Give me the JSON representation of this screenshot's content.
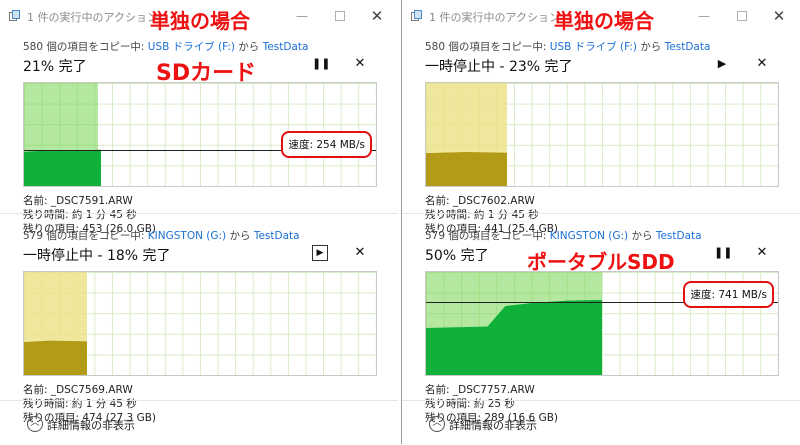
{
  "left": {
    "title": "1 件の実行中のアクション",
    "overlay_title": "単独の場合",
    "overlay_device": "SDカード",
    "op1": {
      "source_prefix": "580 個の項目をコピー中: ",
      "source_link": "USB ドライブ (F:)",
      "source_mid": " から ",
      "dest_link": "TestData",
      "status": "21% 完了",
      "progress": 0.21,
      "speed_label": "速度: 254 MB/s",
      "name": "名前: _DSC7591.ARW",
      "remaining_time": "残り時間: 約 1 分 45 秒",
      "remaining_items": "残りの項目: 453 (26.0 GB)"
    },
    "op2": {
      "source_prefix": "579 個の項目をコピー中: ",
      "source_link": "KINGSTON (G:)",
      "source_mid": " から ",
      "dest_link": "TestData",
      "status": "一時停止中 - 18% 完了",
      "progress": 0.18,
      "name": "名前: _DSC7569.ARW",
      "remaining_time": "残り時間: 約 1 分 45 秒",
      "remaining_items": "残りの項目: 474 (27.3 GB)"
    },
    "footer_label": "詳細情報の非表示"
  },
  "right": {
    "title": "1 件の実行中のアクション",
    "overlay_title": "単独の場合",
    "overlay_device": "ポータブルSDD",
    "op1": {
      "source_prefix": "580 個の項目をコピー中: ",
      "source_link": "USB ドライブ (F:)",
      "source_mid": " から ",
      "dest_link": "TestData",
      "status": "一時停止中 - 23% 完了",
      "progress": 0.23,
      "name": "名前: _DSC7602.ARW",
      "remaining_time": "残り時間: 約 1 分 45 秒",
      "remaining_items": "残りの項目: 441 (25.4 GB)"
    },
    "op2": {
      "source_prefix": "579 個の項目をコピー中: ",
      "source_link": "KINGSTON (G:)",
      "source_mid": " から ",
      "dest_link": "TestData",
      "status": "50% 完了",
      "progress": 0.5,
      "speed_label": "速度: 741 MB/s",
      "name": "名前: _DSC7757.ARW",
      "remaining_time": "残り時間: 約 25 秒",
      "remaining_items": "残りの項目: 289 (16.6 GB)"
    },
    "footer_label": "詳細情報の非表示"
  },
  "colors": {
    "link": "#1a6fd6",
    "annotation": "#ee1111",
    "progress_active": "#77d652",
    "progress_paused": "#ebe182",
    "speed_active": "#0fb13a",
    "speed_paused": "#b39a17"
  },
  "icons": {
    "app": "copy-icon",
    "pause": "pause-icon",
    "resume": "play-icon",
    "stop": "close-icon",
    "collapse": "chevron-up-icon"
  }
}
